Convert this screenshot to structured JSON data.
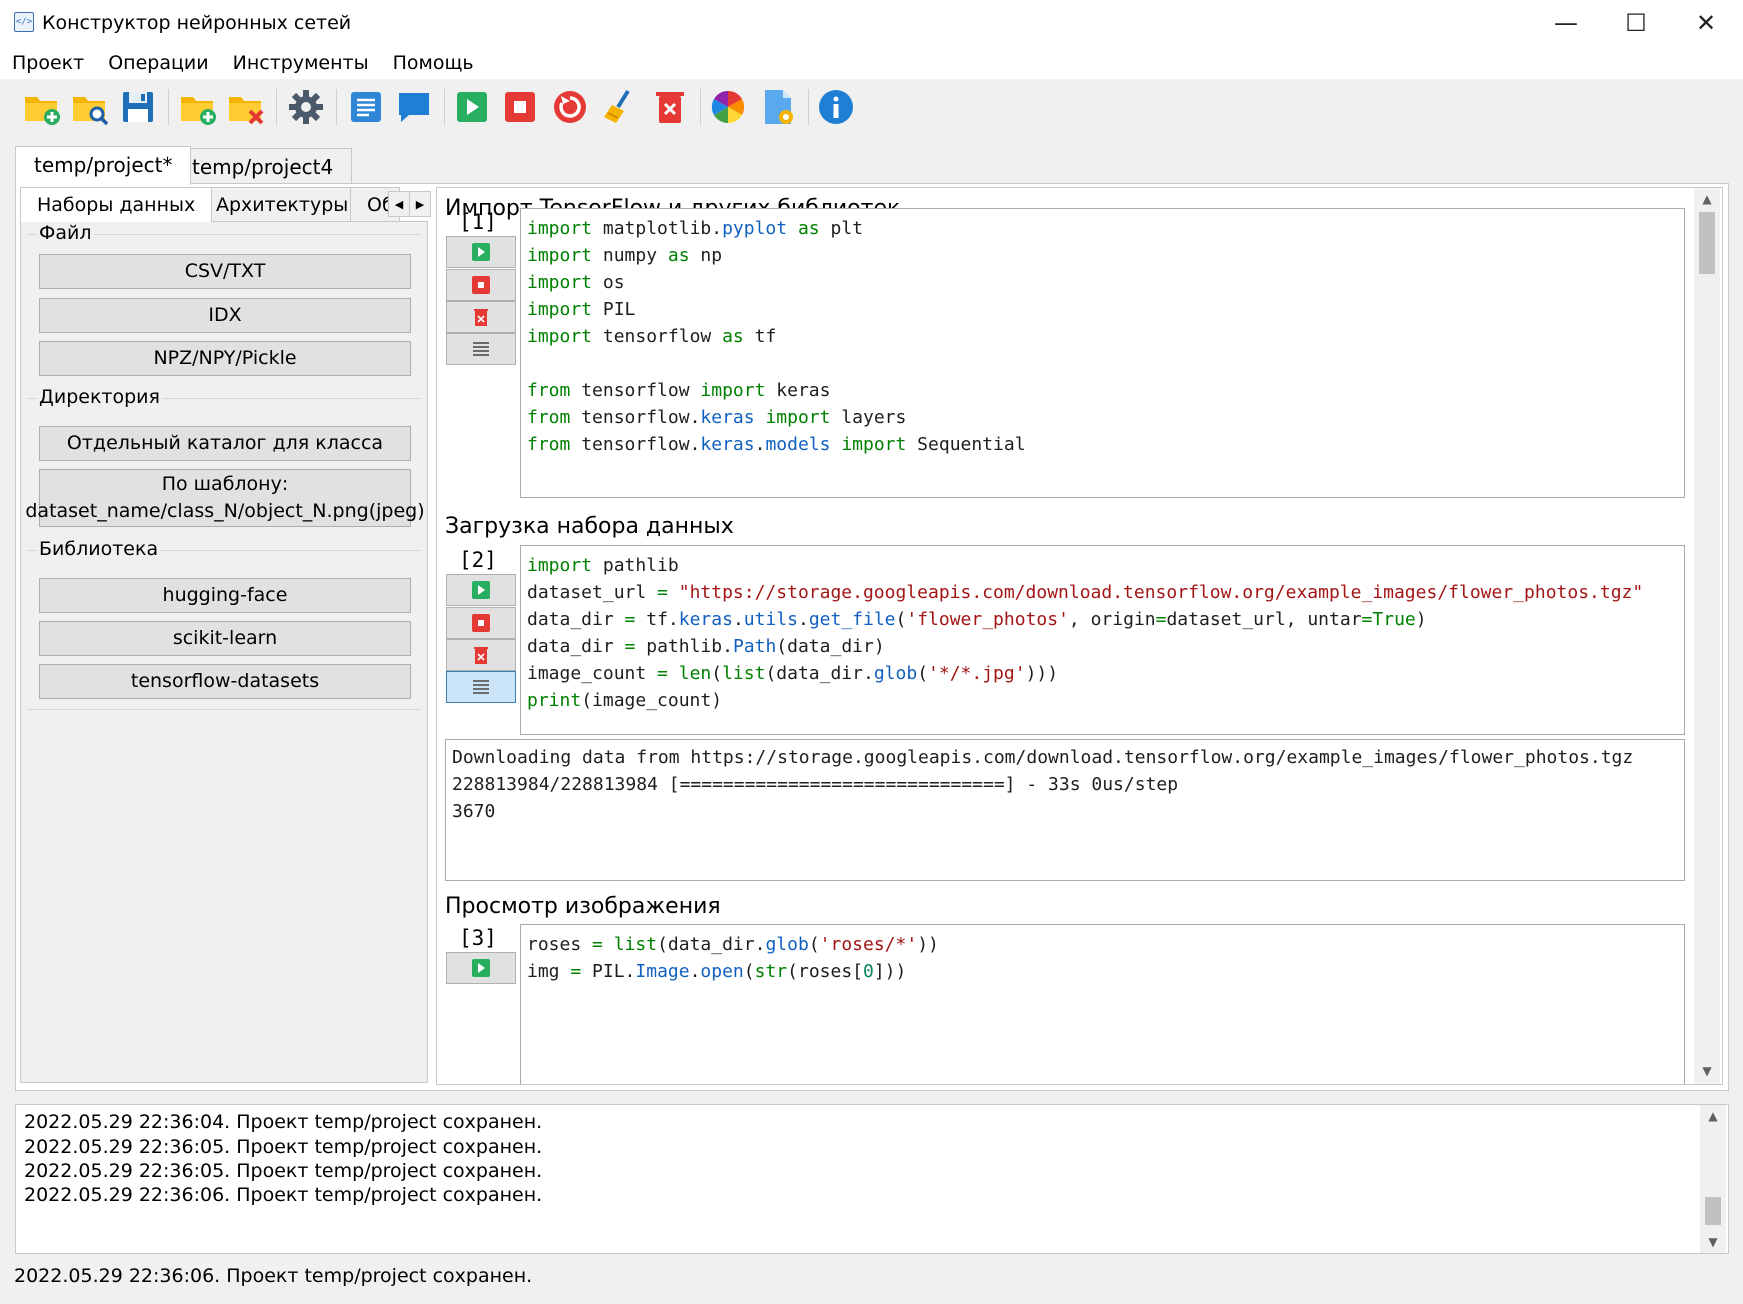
{
  "window": {
    "title": "Конструктор нейронных сетей",
    "minimize": "—",
    "maximize": "☐",
    "close": "✕",
    "app_icon": "</>"
  },
  "menu": [
    "Проект",
    "Операции",
    "Инструменты",
    "Помощь"
  ],
  "toolbar": [
    "new-project-icon",
    "open-project-icon",
    "save-icon",
    "add-folder-icon",
    "remove-folder-icon",
    "settings-icon",
    "text-cell-icon",
    "comment-icon",
    "run-icon",
    "stop-icon",
    "restart-icon",
    "clear-icon",
    "delete-icon",
    "color-palette-icon",
    "document-settings-icon",
    "info-icon"
  ],
  "project_tabs": [
    "temp/project*",
    "temp/project4"
  ],
  "left_tabs": [
    "Наборы данных",
    "Архитектуры",
    "Об"
  ],
  "groups": {
    "file": {
      "title": "Файл",
      "buttons": [
        "CSV/TXT",
        "IDX",
        "NPZ/NPY/Pickle"
      ]
    },
    "directory": {
      "title": "Директория",
      "buttons": [
        "Отдельный каталог для класса",
        "По шаблону:",
        "dataset_name/class_N/object_N.png(jpeg)"
      ]
    },
    "library": {
      "title": "Библиотека",
      "buttons": [
        "hugging-face",
        "scikit-learn",
        "tensorflow-datasets"
      ]
    }
  },
  "cells": [
    {
      "title": "Импорт TensorFlow и других библиотек",
      "number": "[1]"
    },
    {
      "title": "Загрузка набора данных",
      "number": "[2]"
    },
    {
      "title": "Просмотр изображения",
      "number": "[3]"
    }
  ],
  "output2": [
    "Downloading data from https://storage.googleapis.com/download.tensorflow.org/example_images/flower_photos.tgz",
    "228813984/228813984 [==============================] - 33s 0us/step",
    "3670"
  ],
  "log": [
    "2022.05.29 22:36:04. Проект temp/project сохранен.",
    "2022.05.29 22:36:05. Проект temp/project сохранен.",
    "2022.05.29 22:36:05. Проект temp/project сохранен.",
    "2022.05.29 22:36:06. Проект temp/project сохранен."
  ],
  "status": "2022.05.29 22:36:06. Проект temp/project сохранен."
}
